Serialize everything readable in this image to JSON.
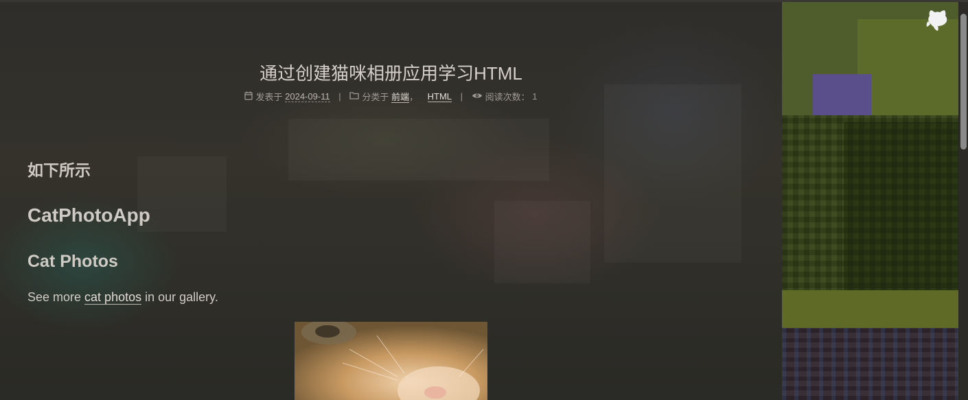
{
  "post": {
    "title": "通过创建猫咪相册应用学习HTML",
    "meta": {
      "posted_label": "发表于",
      "posted_date": "2024-09-11",
      "category_label": "分类于",
      "categories": [
        "前端",
        "HTML"
      ],
      "category_sep": "，",
      "views_label": "阅读次数：",
      "views": "1",
      "separator": "|"
    }
  },
  "content": {
    "intro_heading": "如下所示",
    "app_heading": "CatPhotoApp",
    "photos_heading": "Cat Photos",
    "para_before": "See more ",
    "para_link": "cat photos",
    "para_after": " in our gallery."
  },
  "icons": {
    "calendar": "calendar-icon",
    "folder": "folder-icon",
    "eye": "eye-icon",
    "github": "github-icon"
  },
  "colors": {
    "background": "#2c2a27",
    "text": "#cfcbc4",
    "meta": "#9f9a93"
  }
}
